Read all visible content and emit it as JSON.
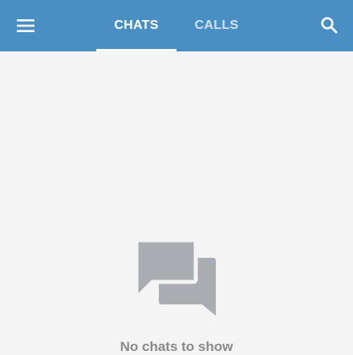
{
  "header": {
    "tabs": [
      {
        "label": "CHATS",
        "active": true
      },
      {
        "label": "CALLS",
        "active": false
      }
    ],
    "menu_icon": "menu-icon",
    "search_icon": "search-icon"
  },
  "empty_state": {
    "icon": "chats-icon",
    "message": "No chats to show"
  },
  "colors": {
    "appbar": "#4a8fc4",
    "background": "#f4f4f4",
    "icon": "#a9acb0",
    "text_muted": "#8a8a8a"
  }
}
